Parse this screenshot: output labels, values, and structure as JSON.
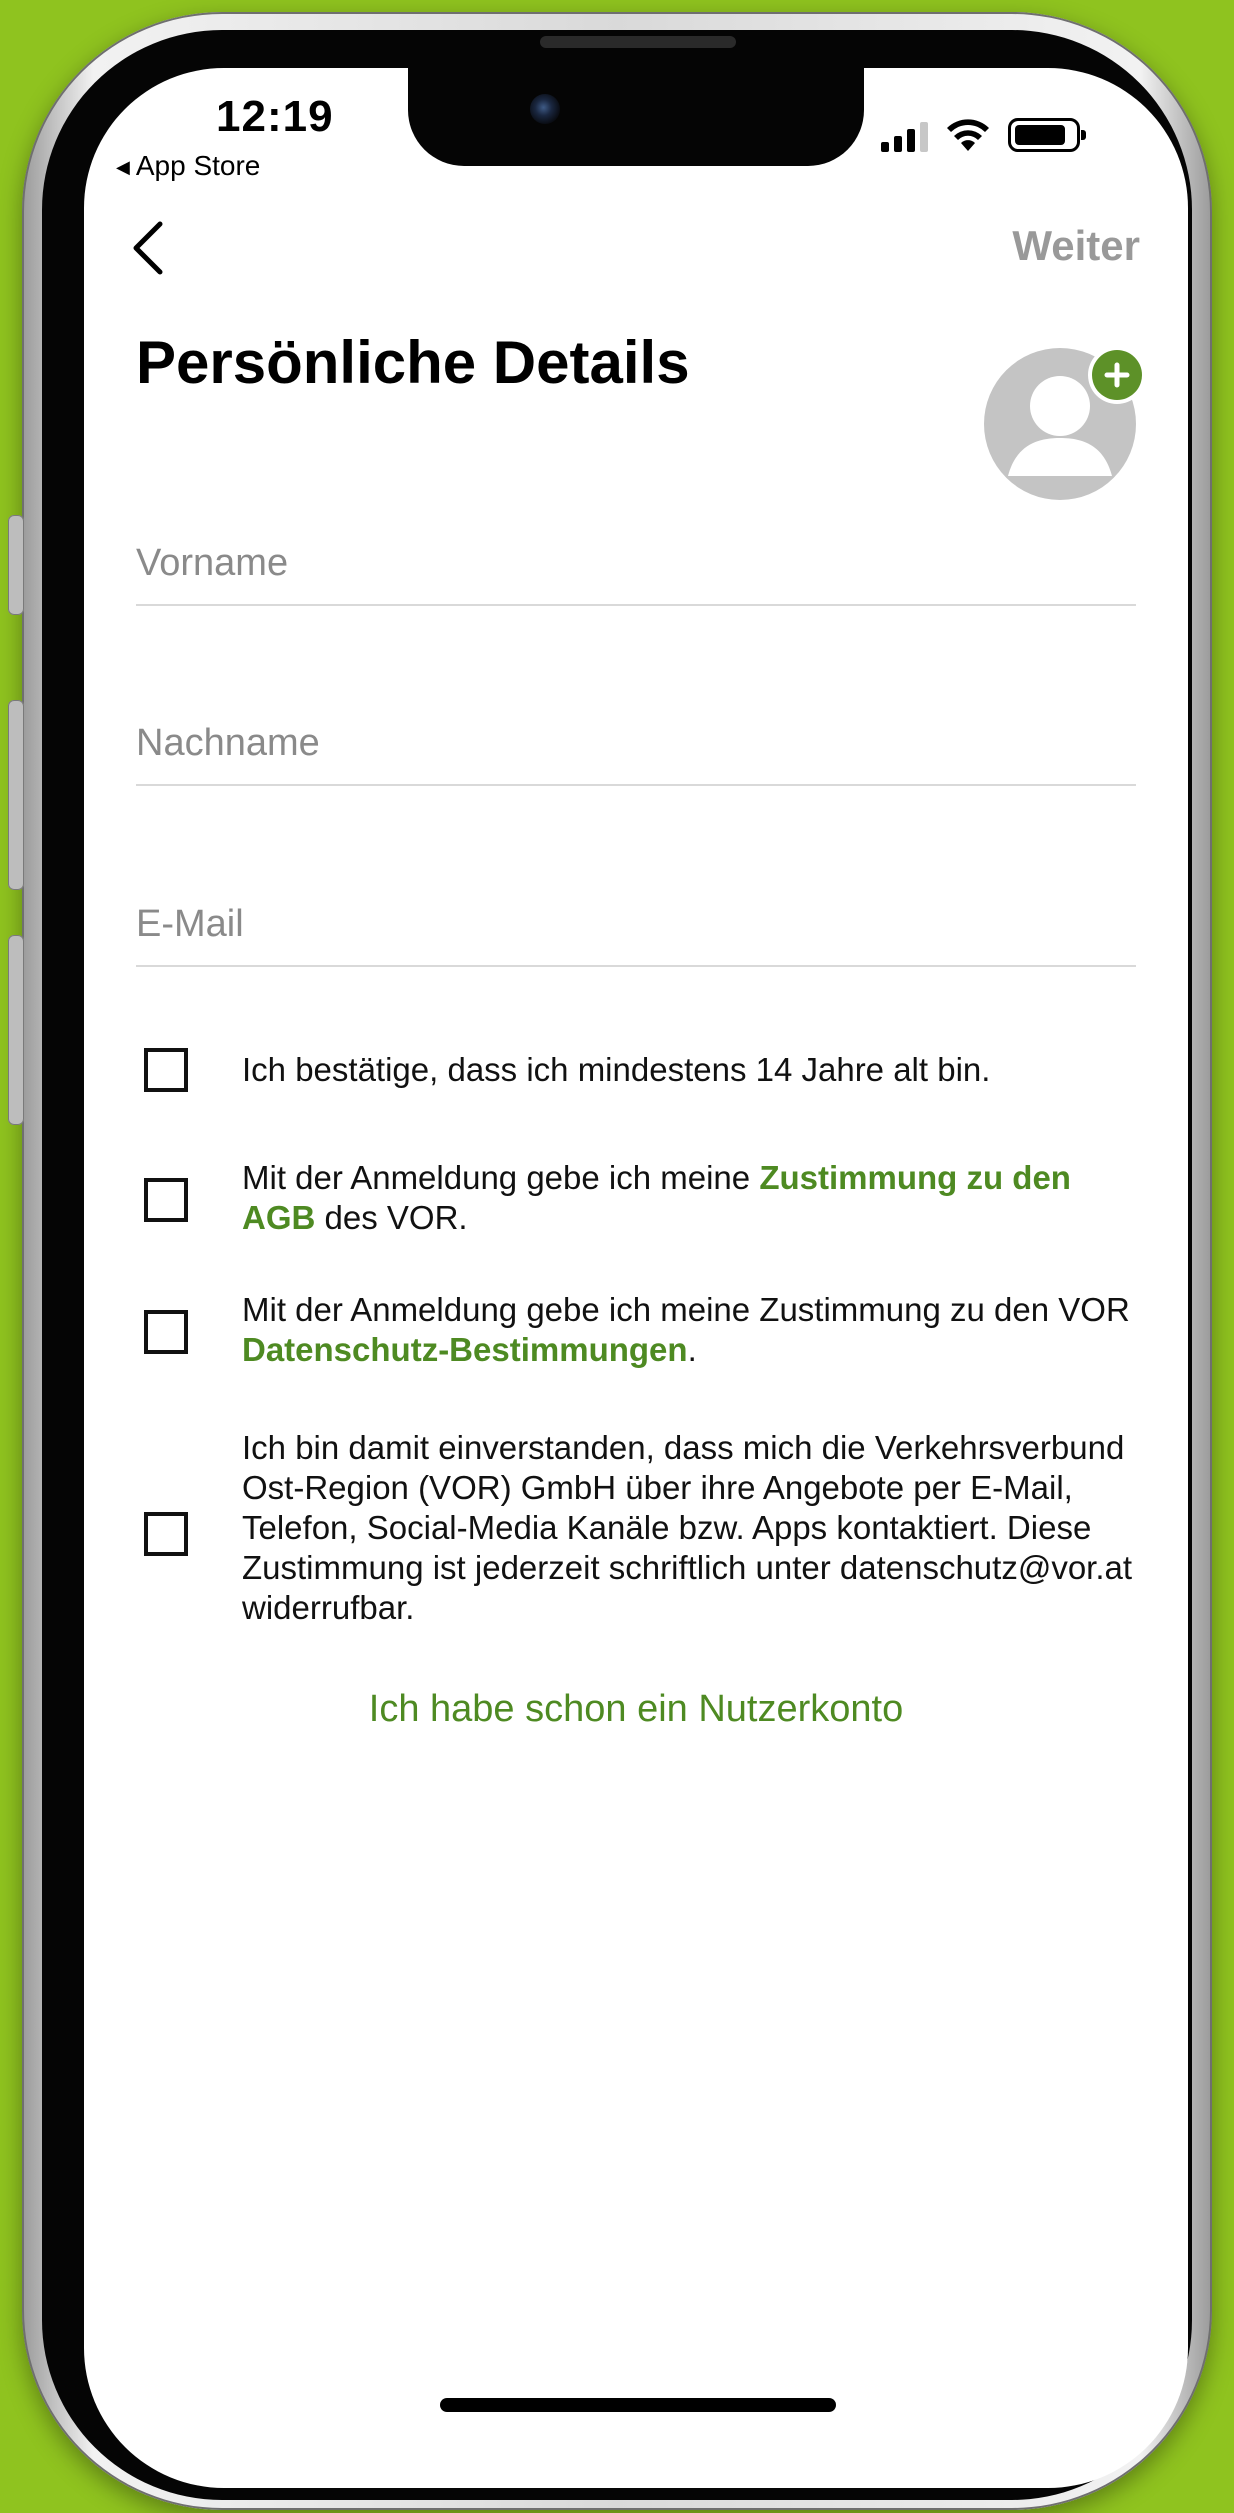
{
  "status_bar": {
    "time": "12:19",
    "back_app": "App Store",
    "back_app_icon": "back-triangle-icon",
    "icons": [
      "signal-icon",
      "wifi-icon",
      "battery-icon"
    ]
  },
  "nav": {
    "back_icon": "chevron-left-icon",
    "next_label": "Weiter"
  },
  "page": {
    "title": "Persönliche Details",
    "avatar_icon": "user-placeholder-icon",
    "avatar_add_icon": "plus-icon"
  },
  "form": {
    "first_name": {
      "placeholder": "Vorname",
      "value": ""
    },
    "last_name": {
      "placeholder": "Nachname",
      "value": ""
    },
    "email": {
      "placeholder": "E-Mail",
      "value": ""
    }
  },
  "consents": {
    "age": "Ich bestätige, dass ich mindestens 14 Jahre alt bin.",
    "agb_prefix": "Mit der Anmeldung gebe ich meine ",
    "agb_link": "Zustimmung zu den AGB",
    "agb_suffix": " des VOR.",
    "privacy_prefix": "Mit der Anmeldung gebe ich meine Zustimmung zu den VOR ",
    "privacy_link": "Datenschutz-Bestimmungen",
    "privacy_suffix": ".",
    "marketing": "Ich bin damit einverstanden, dass mich die Verkehrsverbund Ost-Region (VOR) GmbH über ihre Angebote per E-Mail, Telefon, Social-Media Kanäle bzw. Apps kontaktiert. Diese Zustimmung ist jederzeit schriftlich unter datenschutz@vor.at widerrufbar."
  },
  "login_link": "Ich habe schon ein Nutzerkonto",
  "colors": {
    "accent_green": "#4e8a22",
    "background_green": "#8fc31f",
    "muted_gray": "#999999"
  }
}
